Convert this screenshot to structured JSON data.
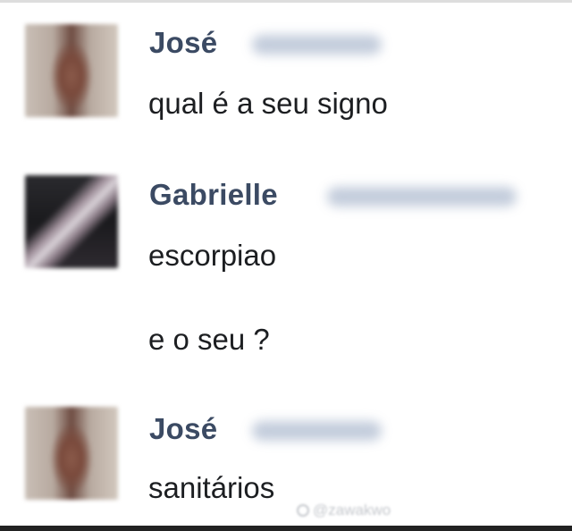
{
  "messages": [
    {
      "sender": "José",
      "avatar": "profile-photo",
      "lines": [
        "qual é a seu signo"
      ]
    },
    {
      "sender": "Gabrielle",
      "avatar": "profile-photo",
      "lines": [
        "escorpiao",
        "e o seu ?"
      ]
    },
    {
      "sender": "José",
      "avatar": "profile-photo",
      "lines": [
        "sanitários"
      ]
    }
  ],
  "watermark": {
    "icon": "tiktok-logo-icon",
    "text": "@zawakwo"
  },
  "colors": {
    "name": "#3b4a63",
    "text": "#1c1e21",
    "background": "#ffffff"
  }
}
